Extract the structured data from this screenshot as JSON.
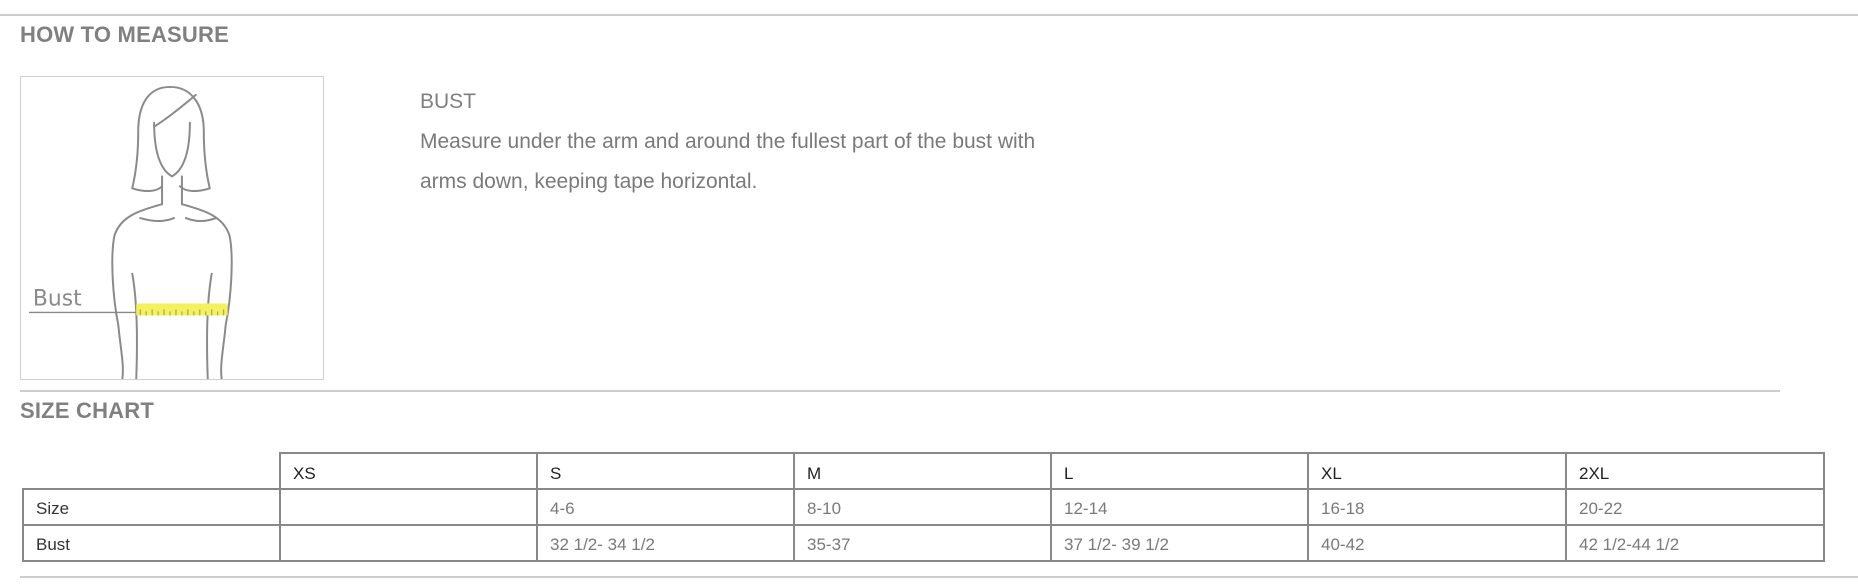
{
  "how_to_measure": {
    "title": "HOW TO MEASURE",
    "figure_label": "Bust",
    "heading": "BUST",
    "description": "Measure under the arm and around the fullest part of the bust with arms down, keeping tape horizontal."
  },
  "size_chart": {
    "title": "SIZE CHART",
    "columns": [
      "XS",
      "S",
      "M",
      "L",
      "XL",
      "2XL"
    ],
    "rows": [
      {
        "label": "Size",
        "values": [
          "",
          "4-6",
          "8-10",
          "12-14",
          "16-18",
          "20-22"
        ]
      },
      {
        "label": "Bust",
        "values": [
          "",
          "32 1/2- 34 1/2",
          "35-37",
          "37 1/2- 39 1/2",
          "40-42",
          "42 1/2-44 1/2"
        ]
      }
    ]
  },
  "colors": {
    "text": "#777777",
    "rule": "#cccccc",
    "table_border": "#888888",
    "tape": "#f4f060"
  }
}
